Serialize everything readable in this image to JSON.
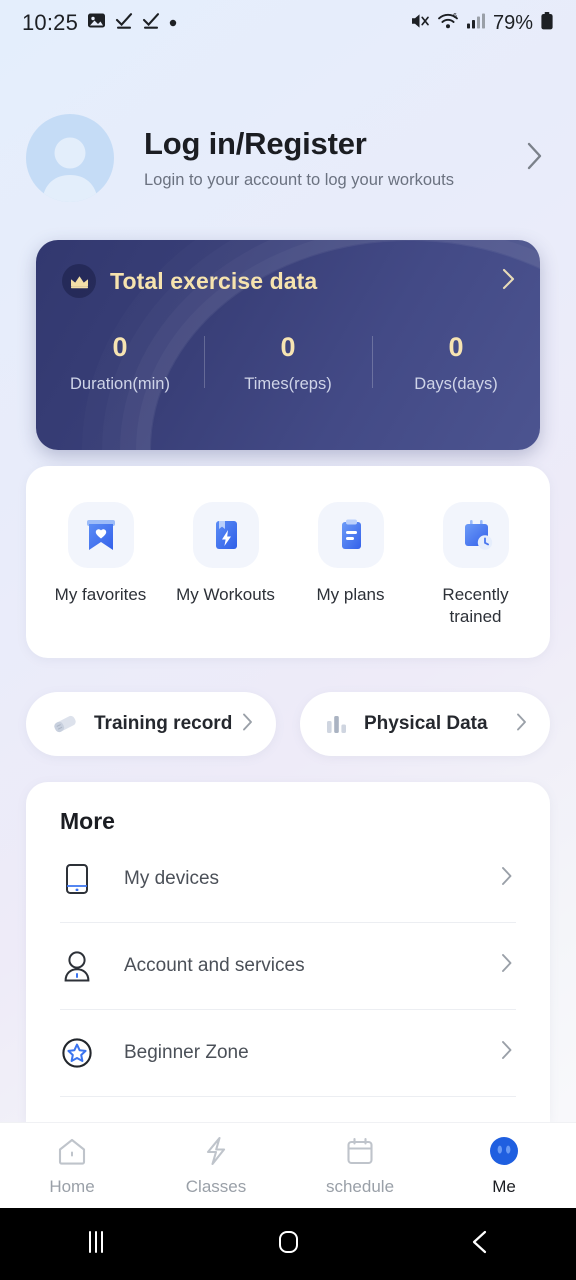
{
  "status_bar": {
    "time": "10:25",
    "battery_text": "79%",
    "left_icons": [
      "image-icon",
      "task-complete-icon",
      "task-complete-icon",
      "dot-icon"
    ],
    "right_icons": [
      "mute-icon",
      "wifi-icon",
      "cellular-signal-icon",
      "battery-icon"
    ]
  },
  "profile": {
    "title": "Log in/Register",
    "subtitle": "Login to your account to log your workouts",
    "avatar_icon": "person-icon",
    "chevron_icon": "chevron-right-icon",
    "avatar_bg": "#c5dcf6"
  },
  "exercise_card": {
    "title": "Total exercise data",
    "badge_icon": "crown-icon",
    "chevron_icon": "chevron-right-icon",
    "accent_text": "#f6e3ae",
    "card_bg": "#383e77",
    "stats": [
      {
        "value": "0",
        "label": "Duration(min)"
      },
      {
        "value": "0",
        "label": "Times(reps)"
      },
      {
        "value": "0",
        "label": "Days(days)"
      }
    ]
  },
  "quick_actions": [
    {
      "label": "My favorites",
      "icon": "bookmark-heart-icon"
    },
    {
      "label": "My Workouts",
      "icon": "book-lightning-icon"
    },
    {
      "label": "My plans",
      "icon": "clipboard-icon"
    },
    {
      "label": "Recently trained",
      "icon": "calendar-clock-icon"
    }
  ],
  "mini_cards": [
    {
      "label": "Training record",
      "icon": "eraser-icon",
      "chevron_icon": "chevron-right-icon"
    },
    {
      "label": "Physical Data",
      "icon": "bar-chart-icon",
      "chevron_icon": "chevron-right-icon"
    }
  ],
  "more": {
    "title": "More",
    "rows": [
      {
        "label": "My devices",
        "icon": "device-icon",
        "chevron_icon": "chevron-right-icon"
      },
      {
        "label": "Account and services",
        "icon": "account-icon",
        "chevron_icon": "chevron-right-icon"
      },
      {
        "label": "Beginner Zone",
        "icon": "star-circle-icon",
        "chevron_icon": "chevron-right-icon"
      }
    ]
  },
  "bottom_nav": {
    "active_color": "#2563eb",
    "items": [
      {
        "label": "Home",
        "icon": "house-icon",
        "active": false
      },
      {
        "label": "Classes",
        "icon": "lightning-icon",
        "active": false
      },
      {
        "label": "schedule",
        "icon": "calendar-icon",
        "active": false
      },
      {
        "label": "Me",
        "icon": "me-avatar-icon",
        "active": true
      }
    ]
  },
  "android_nav": {
    "items": [
      {
        "icon": "recents-icon"
      },
      {
        "icon": "home-square-icon"
      },
      {
        "icon": "back-chevron-icon"
      }
    ]
  }
}
